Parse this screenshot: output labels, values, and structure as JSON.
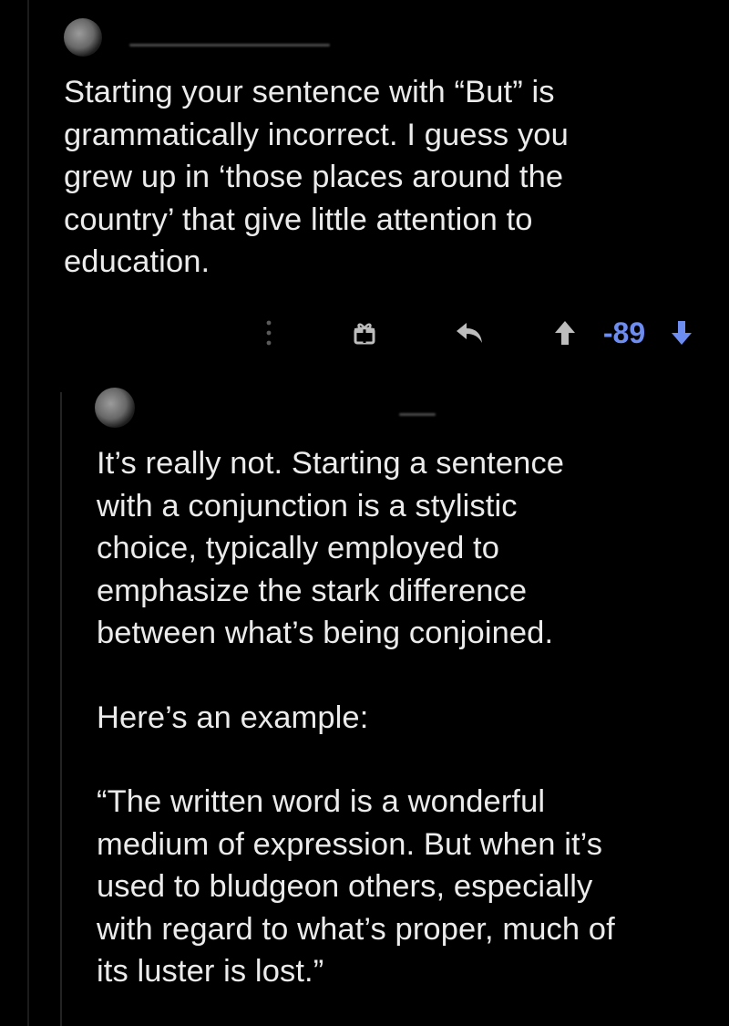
{
  "comment": {
    "text": "Starting your sentence with “But” is\ngrammatically incorrect. I guess you\ngrew up in ‘those places around the\ncountry’ that give little attention to\neducation."
  },
  "actions": {
    "more_icon": "more-vertical-icon",
    "award_icon": "gift-award-icon",
    "reply_icon": "reply-arrow-icon",
    "upvote_icon": "upvote-arrow-icon",
    "downvote_icon": "downvote-arrow-icon",
    "score": "-89",
    "score_color": "#6e8df0"
  },
  "reply": {
    "paragraph_1": "It’s really not. Starting a sentence\nwith a conjunction is a stylistic\nchoice, typically employed to\nemphasize the stark difference\nbetween what’s being conjoined.",
    "paragraph_2": "Here’s an example:",
    "paragraph_3": "“The written word is a wonderful\nmedium of expression. But when it’s\nused to bludgeon others, especially\nwith regard to what’s proper, much of\nits luster is lost.”"
  }
}
